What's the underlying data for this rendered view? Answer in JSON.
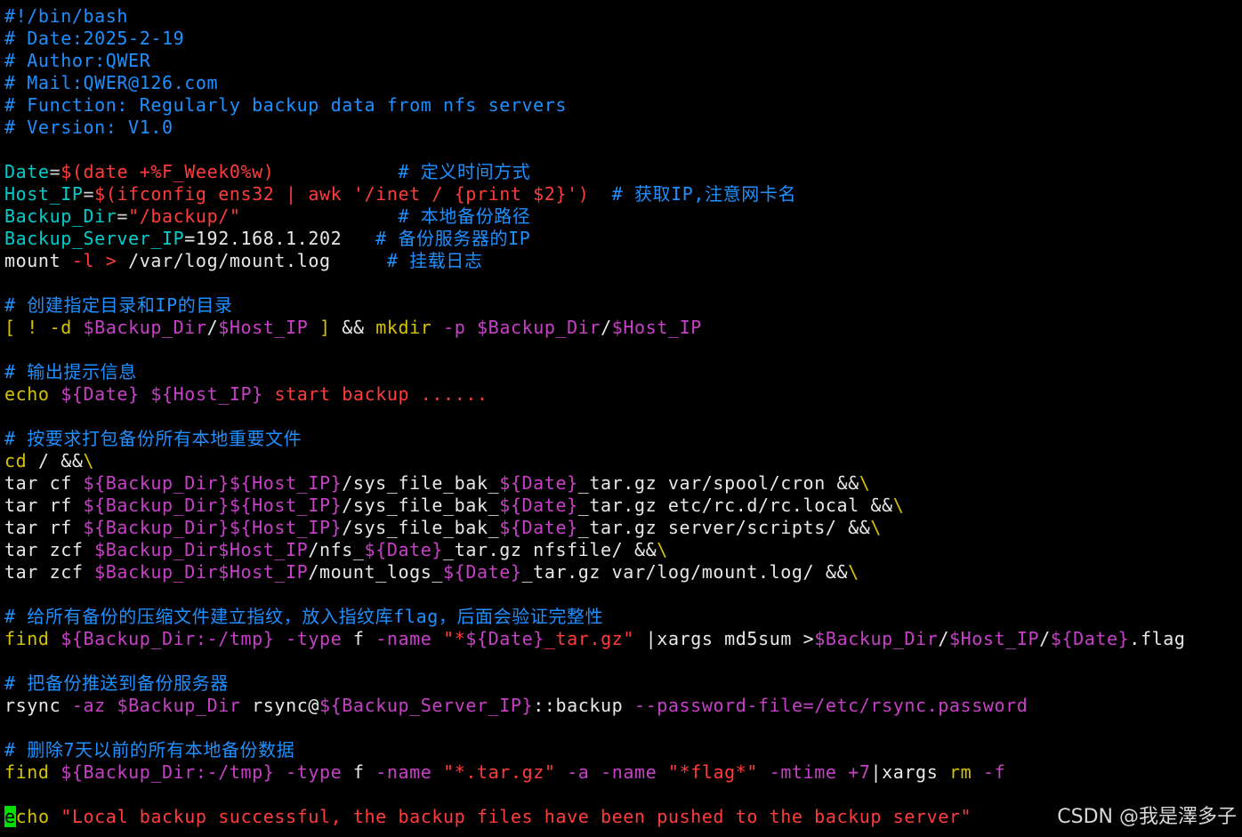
{
  "colors": {
    "background": "#000000",
    "comment": "#1e90ff",
    "identifier": "#00cdcd",
    "string": "#ff3b3b",
    "variable": "#c840c8",
    "keyword": "#d7c400",
    "text": "#e8e8e8",
    "cursor": "#00e000"
  },
  "editor": {
    "cursor_char": "e",
    "lines": [
      [
        [
          "comment",
          "#!/bin/bash"
        ]
      ],
      [
        [
          "comment",
          "# Date:2025-2-19"
        ]
      ],
      [
        [
          "comment",
          "# Author:QWER"
        ]
      ],
      [
        [
          "comment",
          "# Mail:QWER@126.com"
        ]
      ],
      [
        [
          "comment",
          "# Function: Regularly backup data from nfs servers"
        ]
      ],
      [
        [
          "comment",
          "# Version: V1.0"
        ]
      ],
      [],
      [
        [
          "ident",
          "Date"
        ],
        [
          "oper",
          "="
        ],
        [
          "subst",
          "$(date +%F_Week0%w)"
        ],
        [
          "text",
          "           "
        ],
        [
          "comment",
          "# 定义时间方式"
        ]
      ],
      [
        [
          "ident",
          "Host_IP"
        ],
        [
          "oper",
          "="
        ],
        [
          "subst",
          "$(ifconfig ens32 | awk '/inet / {print $2}')"
        ],
        [
          "text",
          "  "
        ],
        [
          "comment",
          "# 获取IP,注意网卡名"
        ]
      ],
      [
        [
          "ident",
          "Backup_Dir"
        ],
        [
          "oper",
          "="
        ],
        [
          "str",
          "\"/backup/\""
        ],
        [
          "text",
          "              "
        ],
        [
          "comment",
          "# 本地备份路径"
        ]
      ],
      [
        [
          "ident",
          "Backup_Server_IP"
        ],
        [
          "text",
          "=192.168.1.202   "
        ],
        [
          "comment",
          "# 备份服务器的IP"
        ]
      ],
      [
        [
          "text",
          "mount "
        ],
        [
          "subst",
          "-l > "
        ],
        [
          "text",
          "/var/log/mount.log     "
        ],
        [
          "comment",
          "# 挂载日志"
        ]
      ],
      [],
      [
        [
          "comment",
          "# 创建指定目录和IP的目录"
        ]
      ],
      [
        [
          "kw",
          "[ ! -d "
        ],
        [
          "var",
          "$Backup_Dir"
        ],
        [
          "text",
          "/"
        ],
        [
          "var",
          "$Host_IP"
        ],
        [
          "kw",
          " ]"
        ],
        [
          "text",
          " && "
        ],
        [
          "kw",
          "mkdir"
        ],
        [
          "opt",
          " -p "
        ],
        [
          "var",
          "$Backup_Dir"
        ],
        [
          "text",
          "/"
        ],
        [
          "var",
          "$Host_IP"
        ]
      ],
      [],
      [
        [
          "comment",
          "# 输出提示信息"
        ]
      ],
      [
        [
          "kw",
          "echo "
        ],
        [
          "var",
          "${Date}"
        ],
        [
          "text",
          " "
        ],
        [
          "var",
          "${Host_IP}"
        ],
        [
          "str",
          " start backup ......"
        ]
      ],
      [],
      [
        [
          "comment",
          "# 按要求打包备份所有本地重要文件"
        ]
      ],
      [
        [
          "kw",
          "cd"
        ],
        [
          "text",
          " / &&"
        ],
        [
          "kw",
          "\\"
        ]
      ],
      [
        [
          "text",
          "tar cf "
        ],
        [
          "var",
          "${Backup_Dir}${Host_IP}"
        ],
        [
          "text",
          "/sys_file_bak_"
        ],
        [
          "var",
          "${Date}"
        ],
        [
          "text",
          "_tar.gz var/spool/cron &&"
        ],
        [
          "kw",
          "\\"
        ]
      ],
      [
        [
          "text",
          "tar rf "
        ],
        [
          "var",
          "${Backup_Dir}${Host_IP}"
        ],
        [
          "text",
          "/sys_file_bak_"
        ],
        [
          "var",
          "${Date}"
        ],
        [
          "text",
          "_tar.gz etc/rc.d/rc.local &&"
        ],
        [
          "kw",
          "\\"
        ]
      ],
      [
        [
          "text",
          "tar rf "
        ],
        [
          "var",
          "${Backup_Dir}${Host_IP}"
        ],
        [
          "text",
          "/sys_file_bak_"
        ],
        [
          "var",
          "${Date}"
        ],
        [
          "text",
          "_tar.gz server/scripts/ &&"
        ],
        [
          "kw",
          "\\"
        ]
      ],
      [
        [
          "text",
          "tar zcf "
        ],
        [
          "var",
          "$Backup_Dir$Host_IP"
        ],
        [
          "text",
          "/nfs_"
        ],
        [
          "var",
          "${Date}"
        ],
        [
          "text",
          "_tar.gz nfsfile/ &&"
        ],
        [
          "kw",
          "\\"
        ]
      ],
      [
        [
          "text",
          "tar zcf "
        ],
        [
          "var",
          "$Backup_Dir$Host_IP"
        ],
        [
          "text",
          "/mount_logs_"
        ],
        [
          "var",
          "${Date}"
        ],
        [
          "text",
          "_tar.gz var/log/mount.log/ &&"
        ],
        [
          "kw",
          "\\"
        ]
      ],
      [],
      [
        [
          "comment",
          "# 给所有备份的压缩文件建立指纹，放入指纹库flag，后面会验证完整性"
        ]
      ],
      [
        [
          "kw",
          "find "
        ],
        [
          "var",
          "${Backup_Dir:-/tmp}"
        ],
        [
          "opt",
          " -type"
        ],
        [
          "text",
          " f "
        ],
        [
          "opt",
          "-name"
        ],
        [
          "text",
          " "
        ],
        [
          "str",
          "\"*"
        ],
        [
          "var",
          "${Date}"
        ],
        [
          "str",
          "_tar.gz\""
        ],
        [
          "text",
          " |xargs md5sum >"
        ],
        [
          "var",
          "$Backup_Dir"
        ],
        [
          "text",
          "/"
        ],
        [
          "var",
          "$Host_IP"
        ],
        [
          "text",
          "/"
        ],
        [
          "var",
          "${Date}"
        ],
        [
          "text",
          ".flag"
        ]
      ],
      [],
      [
        [
          "comment",
          "# 把备份推送到备份服务器"
        ]
      ],
      [
        [
          "text",
          "rsync "
        ],
        [
          "opt",
          "-az "
        ],
        [
          "var",
          "$Backup_Dir"
        ],
        [
          "text",
          " rsync@"
        ],
        [
          "var",
          "${Backup_Server_IP}"
        ],
        [
          "text",
          "::backup "
        ],
        [
          "opt",
          "--password-file=/etc/rsync.password"
        ]
      ],
      [],
      [
        [
          "comment",
          "# 删除7天以前的所有本地备份数据"
        ]
      ],
      [
        [
          "kw",
          "find "
        ],
        [
          "var",
          "${Backup_Dir:-/tmp}"
        ],
        [
          "opt",
          " -type"
        ],
        [
          "text",
          " f "
        ],
        [
          "opt",
          "-name"
        ],
        [
          "text",
          " "
        ],
        [
          "str",
          "\"*.tar.gz\""
        ],
        [
          "opt",
          " -a -name "
        ],
        [
          "str",
          "\"*flag*\""
        ],
        [
          "opt",
          " -mtime +7"
        ],
        [
          "text",
          "|xargs "
        ],
        [
          "kw",
          "rm"
        ],
        [
          "opt",
          " -f"
        ]
      ],
      [],
      [
        [
          "cursor",
          "e"
        ],
        [
          "kw",
          "cho "
        ],
        [
          "str",
          "\"Local backup successful, the backup files have been pushed to the backup server\""
        ]
      ]
    ]
  },
  "watermark": "CSDN @我是澤多子"
}
